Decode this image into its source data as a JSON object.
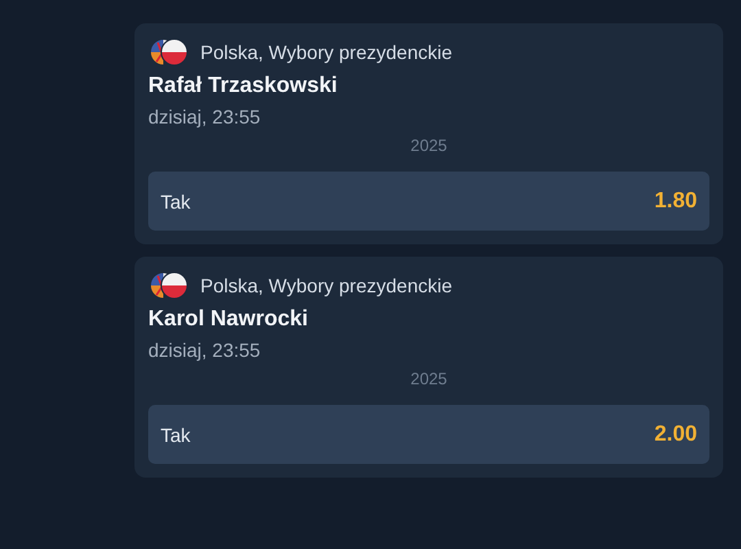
{
  "bets": [
    {
      "category": "Polska, Wybory prezydenckie",
      "selection": "Rafał Trzaskowski",
      "time": "dzisiaj, 23:55",
      "year": "2025",
      "outcome": {
        "label": "Tak",
        "odds": "1.80"
      }
    },
    {
      "category": "Polska, Wybory prezydenckie",
      "selection": "Karol Nawrocki",
      "time": "dzisiaj, 23:55",
      "year": "2025",
      "outcome": {
        "label": "Tak",
        "odds": "2.00"
      }
    }
  ]
}
